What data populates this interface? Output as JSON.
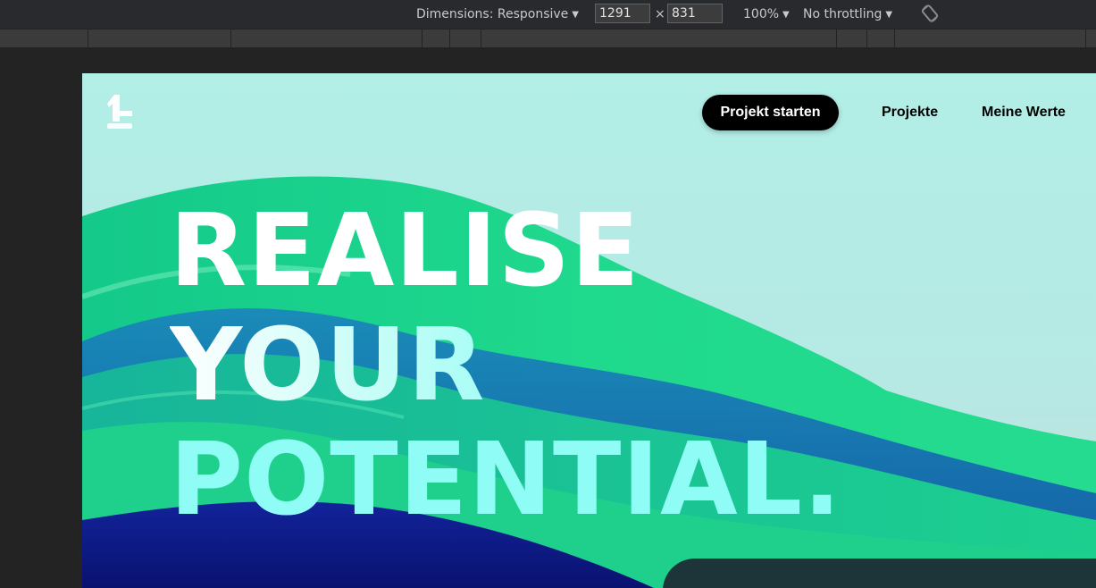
{
  "devtools": {
    "dimensions_label": "Dimensions: Responsive",
    "width_value": "1291",
    "times_symbol": "×",
    "height_value": "831",
    "zoom_label": "100%",
    "throttling_label": "No throttling",
    "caret": "▼"
  },
  "page": {
    "nav": {
      "cta_label": "Projekt starten",
      "links": [
        "Projekte",
        "Meine Werte"
      ]
    },
    "hero": {
      "headline_lines": [
        "REALISE",
        "YOUR",
        "POTENTIAL."
      ]
    }
  },
  "colors": {
    "cta_background": "#000000",
    "headline_white": "#ffffff",
    "headline_cyan": "#8ffcf5",
    "wave_green": "#19d38c",
    "wave_blue": "#0f1f8a",
    "sky": "#b2efe6"
  }
}
